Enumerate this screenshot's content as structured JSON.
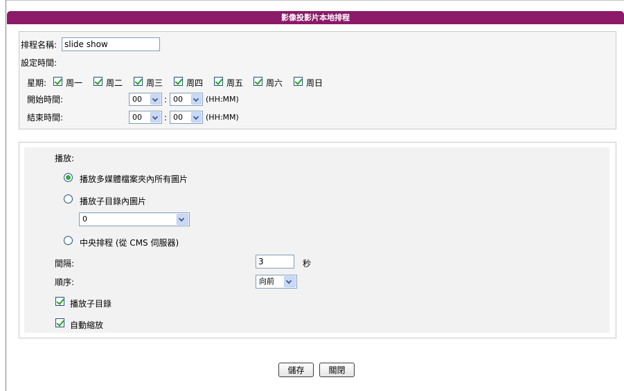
{
  "window": {
    "title": "影像投影片本地排程"
  },
  "schedule": {
    "name_label": "排程名稱:",
    "name_value": "slide show",
    "time_label": "設定時間:",
    "weekday_label": "星期:",
    "days": [
      "周一",
      "周二",
      "周三",
      "周四",
      "周五",
      "周六",
      "周日"
    ],
    "start_label": "開始時間:",
    "end_label": "結束時間:",
    "start_hour": "00",
    "start_minute": "00",
    "end_hour": "00",
    "end_minute": "00",
    "colon": ":",
    "format_hint": "(HH:MM)"
  },
  "playback": {
    "title": "播放:",
    "option_all": "播放多媒體檔案夾內所有圖片",
    "option_subdir": "播放子目錄內圖片",
    "subdir_value": "0",
    "option_cms": "中央排程 (從 CMS 伺服器)",
    "interval_label": "間隔:",
    "interval_value": "3",
    "interval_unit": "秒",
    "order_label": "順序:",
    "order_value": "向前",
    "play_subdirs": "播放子目錄",
    "auto_scale": "自動縮放"
  },
  "footer": {
    "save": "儲存",
    "close": "關閉"
  },
  "colors": {
    "title_bar": "#8b1a68",
    "check": "#21a121"
  }
}
